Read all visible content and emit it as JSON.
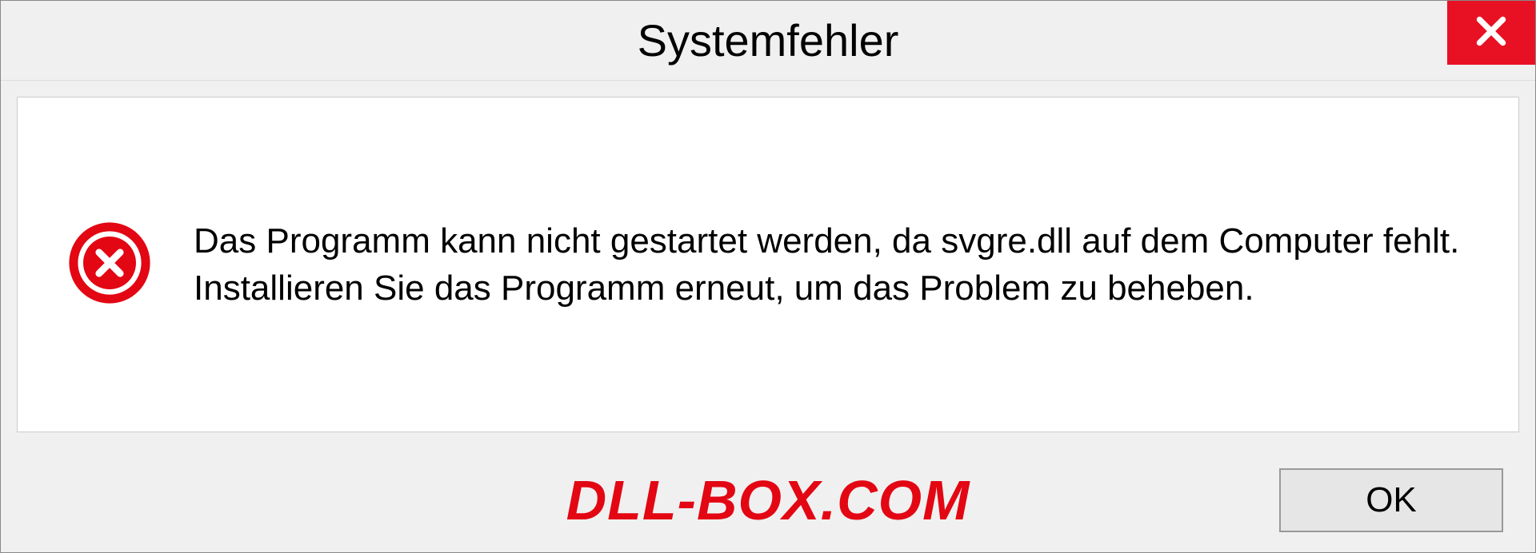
{
  "dialog": {
    "title": "Systemfehler",
    "message": "Das Programm kann nicht gestartet werden, da svgre.dll auf dem Computer fehlt. Installieren Sie das Programm erneut, um das Problem zu beheben.",
    "ok_label": "OK"
  },
  "watermark": "DLL-BOX.COM",
  "colors": {
    "close_button": "#e81123",
    "error_icon": "#e30613",
    "watermark": "#e30613"
  }
}
